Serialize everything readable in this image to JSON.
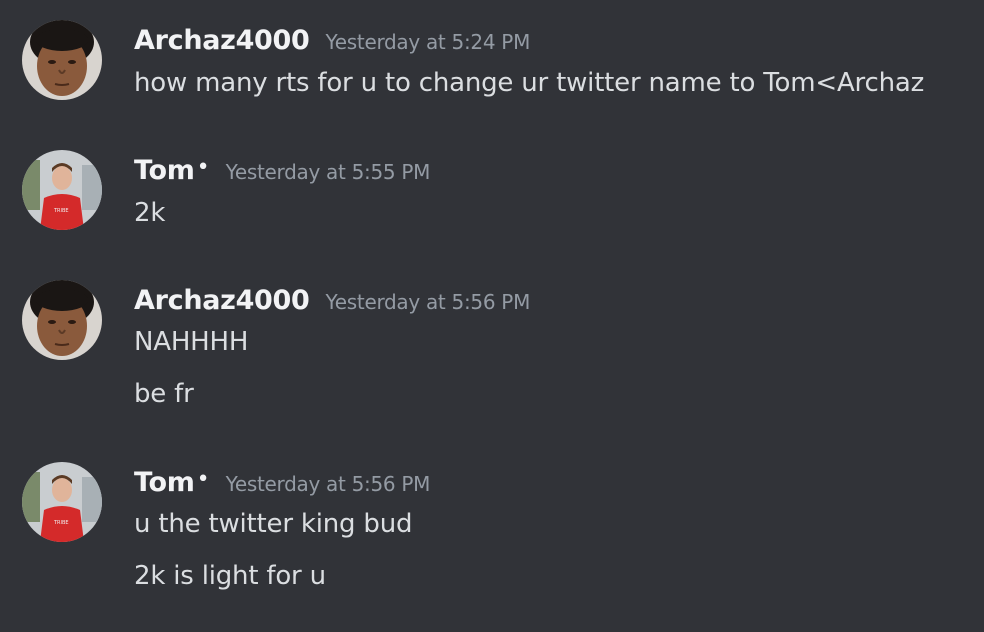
{
  "messages": [
    {
      "username": "Archaz4000",
      "username_suffix": "",
      "timestamp": "Yesterday at 5:24 PM",
      "avatar_icon": "person-face-avatar-icon",
      "lines": [
        "how many rts for u to change ur twitter name to Tom<Archaz"
      ]
    },
    {
      "username": "Tom",
      "username_suffix": "•",
      "timestamp": "Yesterday at 5:55 PM",
      "avatar_icon": "person-red-shirt-avatar-icon",
      "lines": [
        "2k"
      ]
    },
    {
      "username": "Archaz4000",
      "username_suffix": "",
      "timestamp": "Yesterday at 5:56 PM",
      "avatar_icon": "person-face-avatar-icon",
      "lines": [
        "NAHHHH",
        "be fr"
      ]
    },
    {
      "username": "Tom",
      "username_suffix": "•",
      "timestamp": "Yesterday at 5:56 PM",
      "avatar_icon": "person-red-shirt-avatar-icon",
      "lines": [
        "u the twitter king bud",
        "2k is light for u"
      ]
    }
  ],
  "colors": {
    "background": "#313338",
    "username": "#f2f3f5",
    "timestamp": "#949ba4",
    "message_text": "#dbdee1"
  }
}
